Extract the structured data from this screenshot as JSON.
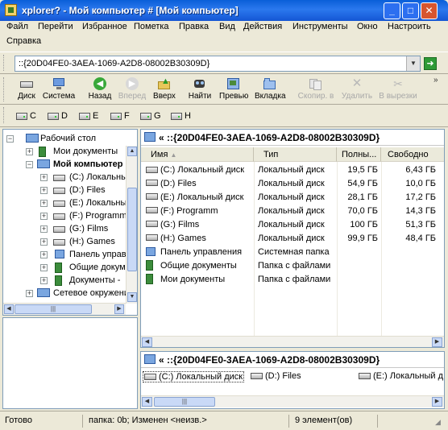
{
  "window": {
    "title": "xplorer? - Мой компьютер # [Мой компьютер]"
  },
  "menu": [
    "Файл",
    "Перейти",
    "Избранное",
    "Пометка",
    "Правка",
    "Вид",
    "Действия",
    "Инструменты",
    "Окно",
    "Настроить",
    "Справка"
  ],
  "address": {
    "value": "::{20D04FE0-3AEA-1069-A2D8-08002B30309D}"
  },
  "toolbar": [
    {
      "label": "Диск",
      "icon": "drive-icon",
      "enabled": true
    },
    {
      "label": "Система",
      "icon": "system-icon",
      "enabled": true
    },
    {
      "label": "Назад",
      "icon": "back-icon",
      "enabled": true
    },
    {
      "label": "Вперед",
      "icon": "forward-icon",
      "enabled": false
    },
    {
      "label": "Вверх",
      "icon": "up-icon",
      "enabled": true
    },
    {
      "label": "Найти",
      "icon": "find-icon",
      "enabled": true
    },
    {
      "label": "Превью",
      "icon": "preview-icon",
      "enabled": true
    },
    {
      "label": "Вкладка",
      "icon": "tab-icon",
      "enabled": true
    },
    {
      "label": "Скопир. в",
      "icon": "copy-to-icon",
      "enabled": false
    },
    {
      "label": "Удалить",
      "icon": "delete-icon",
      "enabled": false
    },
    {
      "label": "В вырезки",
      "icon": "cut-icon",
      "enabled": false
    }
  ],
  "drives": [
    "C",
    "D",
    "E",
    "F",
    "G",
    "H"
  ],
  "tree": [
    {
      "label": "Рабочий стол"
    },
    {
      "label": "Мои документы"
    },
    {
      "label": "Мой компьютер"
    },
    {
      "label": "(C:) Локальный диск"
    },
    {
      "label": "(D:) Files"
    },
    {
      "label": "(E:) Локальный диск"
    },
    {
      "label": "(F:) Programm"
    },
    {
      "label": "(G:) Films"
    },
    {
      "label": "(H:) Games"
    },
    {
      "label": "Панель управления"
    },
    {
      "label": "Общие документы"
    },
    {
      "label": "Документы - "
    },
    {
      "label": "Сетевое окружение"
    }
  ],
  "list": {
    "path": "« ::{20D04FE0-3AEA-1069-A2D8-08002B30309D}",
    "columns": [
      "Имя",
      "Тип",
      "Полны...",
      "Свободно"
    ],
    "rows": [
      {
        "name": "(C:) Локальный диск",
        "type": "Локальный диск",
        "total": "19,5 ГБ",
        "free": "6,43 ГБ",
        "icon": "drive-icon"
      },
      {
        "name": "(D:) Files",
        "type": "Локальный диск",
        "total": "54,9 ГБ",
        "free": "10,0 ГБ",
        "icon": "drive-icon"
      },
      {
        "name": "(E:) Локальный диск",
        "type": "Локальный диск",
        "total": "28,1 ГБ",
        "free": "17,2 ГБ",
        "icon": "drive-icon"
      },
      {
        "name": "(F:) Programm",
        "type": "Локальный диск",
        "total": "70,0 ГБ",
        "free": "14,3 ГБ",
        "icon": "drive-icon"
      },
      {
        "name": "(G:) Films",
        "type": "Локальный диск",
        "total": "100 ГБ",
        "free": "51,3 ГБ",
        "icon": "drive-icon"
      },
      {
        "name": "(H:) Games",
        "type": "Локальный диск",
        "total": "99,9 ГБ",
        "free": "48,4 ГБ",
        "icon": "drive-icon"
      },
      {
        "name": "Панель управления",
        "type": "Системная папка",
        "total": "",
        "free": "",
        "icon": "control-panel-icon"
      },
      {
        "name": "Общие документы",
        "type": "Папка с файлами",
        "total": "",
        "free": "",
        "icon": "folder-icon"
      },
      {
        "name": "Мои документы",
        "type": "Папка с файлами",
        "total": "",
        "free": "",
        "icon": "folder-icon"
      }
    ]
  },
  "bottom": {
    "path": "« ::{20D04FE0-3AEA-1069-A2D8-08002B30309D}",
    "items": [
      "(C:) Локальный диск",
      "(D:) Files",
      "(E:) Локальный д"
    ]
  },
  "status": {
    "left": "Готово",
    "middle": "папка: 0b; Изменен <неизв.>",
    "right": "9 элемент(ов)"
  }
}
